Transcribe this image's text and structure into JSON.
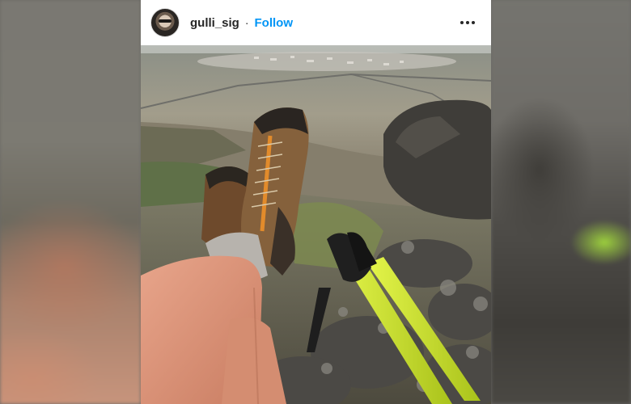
{
  "post": {
    "username": "gulli_sig",
    "separator": "·",
    "follow_label": "Follow",
    "more_icon": "more-options-icon",
    "avatar_icon": "profile-avatar-icon"
  },
  "colors": {
    "follow_blue": "#0095f6",
    "text_dark": "#262626",
    "pole_yellow": "#c9e62a"
  }
}
